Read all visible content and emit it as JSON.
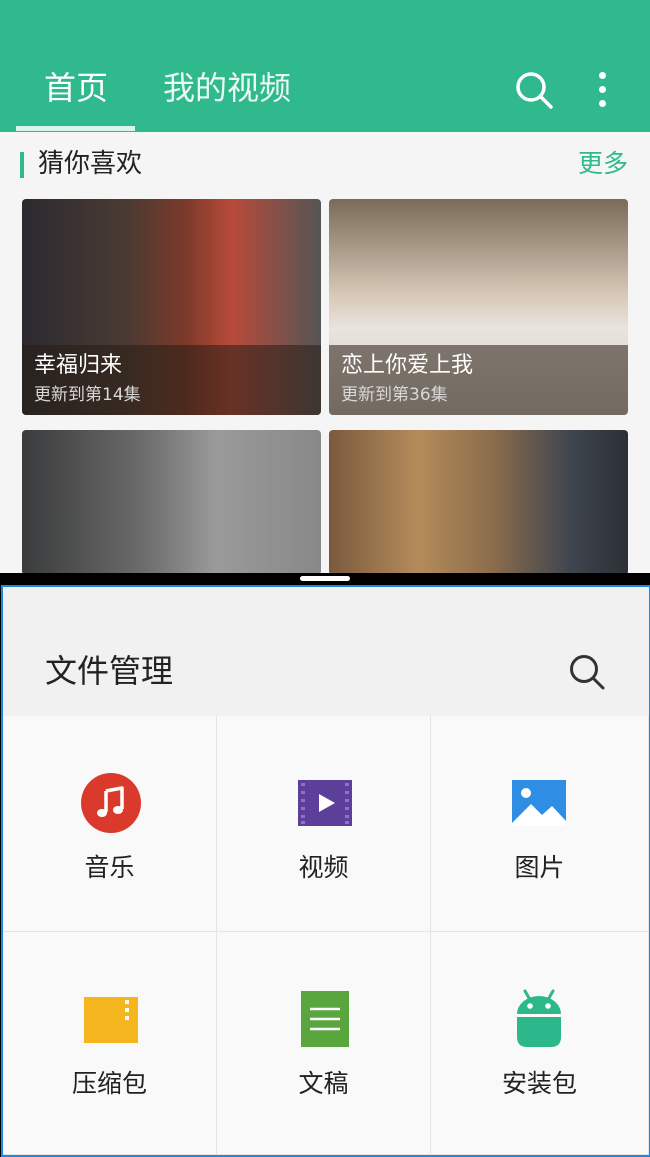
{
  "video_app": {
    "tabs": [
      {
        "label": "首页"
      },
      {
        "label": "我的视频"
      }
    ],
    "section": {
      "title": "猜你喜欢",
      "more": "更多"
    },
    "cards": [
      {
        "title": "幸福归来",
        "subtitle": "更新到第14集"
      },
      {
        "title": "恋上你爱上我",
        "subtitle": "更新到第36集"
      },
      {
        "title": "",
        "subtitle": ""
      },
      {
        "title": "",
        "subtitle": ""
      }
    ],
    "icons": [
      "search-icon",
      "more-vertical-icon"
    ],
    "accent_color": "#2fb98c"
  },
  "file_manager": {
    "title": "文件管理",
    "categories": [
      {
        "label": "音乐",
        "icon": "music-icon",
        "color": "#d93a2b"
      },
      {
        "label": "视频",
        "icon": "video-icon",
        "color": "#5c3f99"
      },
      {
        "label": "图片",
        "icon": "image-icon",
        "color": "#2f8de4"
      },
      {
        "label": "压缩包",
        "icon": "archive-icon",
        "color": "#f4b51f"
      },
      {
        "label": "文稿",
        "icon": "document-icon",
        "color": "#5aa63e"
      },
      {
        "label": "安装包",
        "icon": "android-icon",
        "color": "#2cb88a"
      }
    ],
    "border_color": "#1e88e5"
  }
}
